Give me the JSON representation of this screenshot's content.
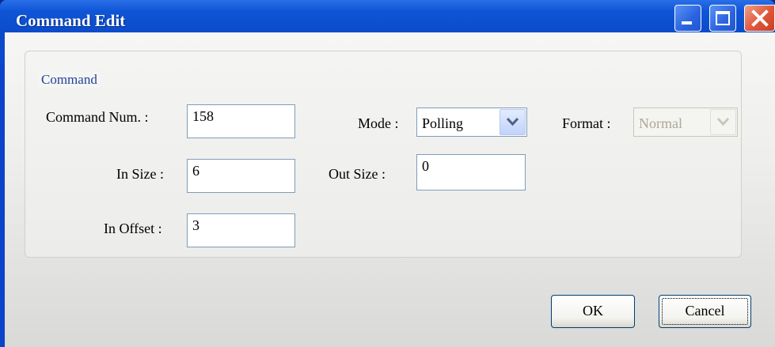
{
  "window": {
    "title": "Command Edit"
  },
  "group": {
    "legend": "Command"
  },
  "fields": {
    "command_num": {
      "label": "Command Num. :",
      "value": "158"
    },
    "in_size": {
      "label": "In Size :",
      "value": "6"
    },
    "in_offset": {
      "label": "In Offset :",
      "value": "3"
    },
    "mode": {
      "label": "Mode :",
      "value": "Polling"
    },
    "out_size": {
      "label": "Out Size :",
      "value": "0"
    },
    "format": {
      "label": "Format :",
      "value": "Normal",
      "disabled": true
    }
  },
  "buttons": {
    "ok": "OK",
    "cancel": "Cancel"
  },
  "colors": {
    "titlebar": "#0a49c8",
    "close": "#e0553a",
    "legend": "#22449a"
  }
}
